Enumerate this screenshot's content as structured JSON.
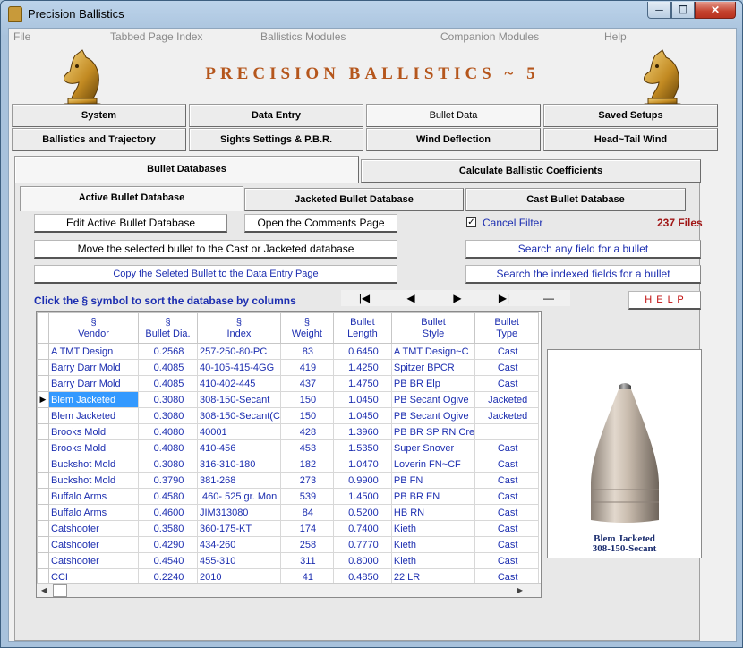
{
  "window": {
    "title": "Precision Ballistics",
    "min": "─",
    "max": "☐",
    "close": "✕"
  },
  "menu": [
    "File",
    "Tabbed Page Index",
    "Ballistics Modules",
    "Companion Modules",
    "Help"
  ],
  "heading": "PRECISION BALLISTICS ~ 5",
  "main_tabs": [
    "System",
    "Data Entry",
    "Bullet Data",
    "Saved Setups",
    "Ballistics and Trajectory",
    "Sights Settings & P.B.R.",
    "Wind Deflection",
    "Head~Tail Wind"
  ],
  "sub_tabs": [
    "Bullet Databases",
    "Calculate Ballistic Coefficients"
  ],
  "db_tabs": [
    "Active Bullet Database",
    "Jacketed Bullet Database",
    "Cast Bullet Database"
  ],
  "buttons": {
    "edit": "Edit Active Bullet Database",
    "comments": "Open the Comments Page",
    "move": "Move the selected bullet to the  Cast or Jacketed database",
    "copy": "Copy the Seleted Bullet to the Data Entry Page",
    "search_any": "Search any field for a  bullet",
    "search_indexed": "Search the indexed fields for a  bullet",
    "help": "H E L P"
  },
  "filter": {
    "label": "Cancel Filter",
    "checked": true
  },
  "file_count": "237 Files",
  "sort_hint": "Click the  §  symbol to sort the database by  columns",
  "nav": [
    "|◀",
    "◀",
    "▶",
    "▶|",
    "—"
  ],
  "grid": {
    "columns": [
      {
        "sym": "§",
        "label": "Vendor"
      },
      {
        "sym": "§",
        "label": "Bullet Dia."
      },
      {
        "sym": "§",
        "label": "Index"
      },
      {
        "sym": "§",
        "label": "Weight"
      },
      {
        "sym": "Bullet",
        "label": "Length"
      },
      {
        "sym": "Bullet",
        "label": "Style"
      },
      {
        "sym": "Bullet",
        "label": "Type"
      }
    ],
    "selected_row": 3,
    "rows": [
      [
        "A TMT Design",
        "0.2568",
        "257-250-80-PC",
        "83",
        "0.6450",
        "A TMT Design~C",
        "Cast"
      ],
      [
        "Barry Darr Mold",
        "0.4085",
        "40-105-415-4GG",
        "419",
        "1.4250",
        "Spitzer BPCR",
        "Cast"
      ],
      [
        "Barry Darr Mold",
        "0.4085",
        "410-402-445",
        "437",
        "1.4750",
        "PB BR Elp",
        "Cast"
      ],
      [
        "Blem Jacketed",
        "0.3080",
        "308-150-Secant",
        "150",
        "1.0450",
        "PB Secant Ogive",
        "Jacketed"
      ],
      [
        "Blem Jacketed",
        "0.3080",
        "308-150-Secant(C",
        "150",
        "1.0450",
        "PB Secant Ogive",
        "Jacketed"
      ],
      [
        "Brooks Mold",
        "0.4080",
        "40001",
        "428",
        "1.3960",
        "PB BR SP RN Cre",
        ""
      ],
      [
        "Brooks Mold",
        "0.4080",
        "410-456",
        "453",
        "1.5350",
        "Super Snover",
        "Cast"
      ],
      [
        "Buckshot Mold",
        "0.3080",
        "316-310-180",
        "182",
        "1.0470",
        "Loverin FN~CF",
        "Cast"
      ],
      [
        "Buckshot Mold",
        "0.3790",
        "381-268",
        "273",
        "0.9900",
        "PB FN",
        "Cast"
      ],
      [
        "Buffalo Arms",
        "0.4580",
        ".460- 525 gr. Mon",
        "539",
        "1.4500",
        "PB BR EN",
        "Cast"
      ],
      [
        "Buffalo Arms",
        "0.4600",
        "JIM313080",
        "84",
        "0.5200",
        "HB RN",
        "Cast"
      ],
      [
        "Catshooter",
        "0.3580",
        "360-175-KT",
        "174",
        "0.7400",
        "Kieth",
        "Cast"
      ],
      [
        "Catshooter",
        "0.4290",
        "434-260",
        "258",
        "0.7770",
        "Kieth",
        "Cast"
      ],
      [
        "Catshooter",
        "0.4540",
        "455-310",
        "311",
        "0.8000",
        "Kieth",
        "Cast"
      ],
      [
        "CCI",
        "0.2240",
        "2010",
        "41",
        "0.4850",
        "22 LR",
        "Cast"
      ]
    ]
  },
  "preview": {
    "line1": "Blem Jacketed",
    "line2": "308-150-Secant"
  }
}
